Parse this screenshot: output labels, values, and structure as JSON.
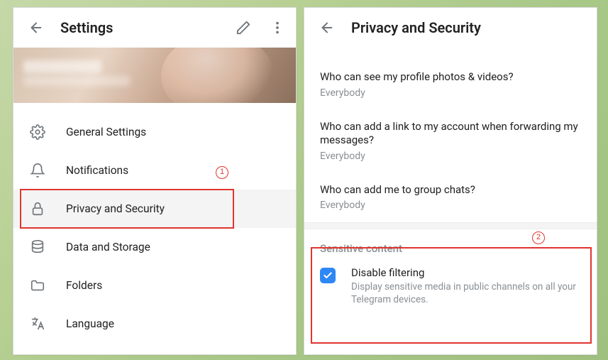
{
  "left": {
    "title": "Settings",
    "menu": [
      {
        "icon": "gear",
        "label": "General Settings"
      },
      {
        "icon": "bell",
        "label": "Notifications"
      },
      {
        "icon": "lock",
        "label": "Privacy and Security"
      },
      {
        "icon": "database",
        "label": "Data and Storage"
      },
      {
        "icon": "folder",
        "label": "Folders"
      },
      {
        "icon": "language",
        "label": "Language"
      }
    ]
  },
  "right": {
    "title": "Privacy and Security",
    "items": [
      {
        "title": "Who can see my profile photos & videos?",
        "value": "Everybody"
      },
      {
        "title": "Who can add a link to my account when forwarding my messages?",
        "value": "Everybody"
      },
      {
        "title": "Who can add me to group chats?",
        "value": "Everybody"
      }
    ],
    "sensitive": {
      "section_label": "Sensitive content",
      "checkbox_label": "Disable filtering",
      "checkbox_desc": "Display sensitive media in public channels on all your Telegram devices.",
      "checked": true
    }
  },
  "annotations": {
    "marker1": "1",
    "marker2": "2"
  }
}
